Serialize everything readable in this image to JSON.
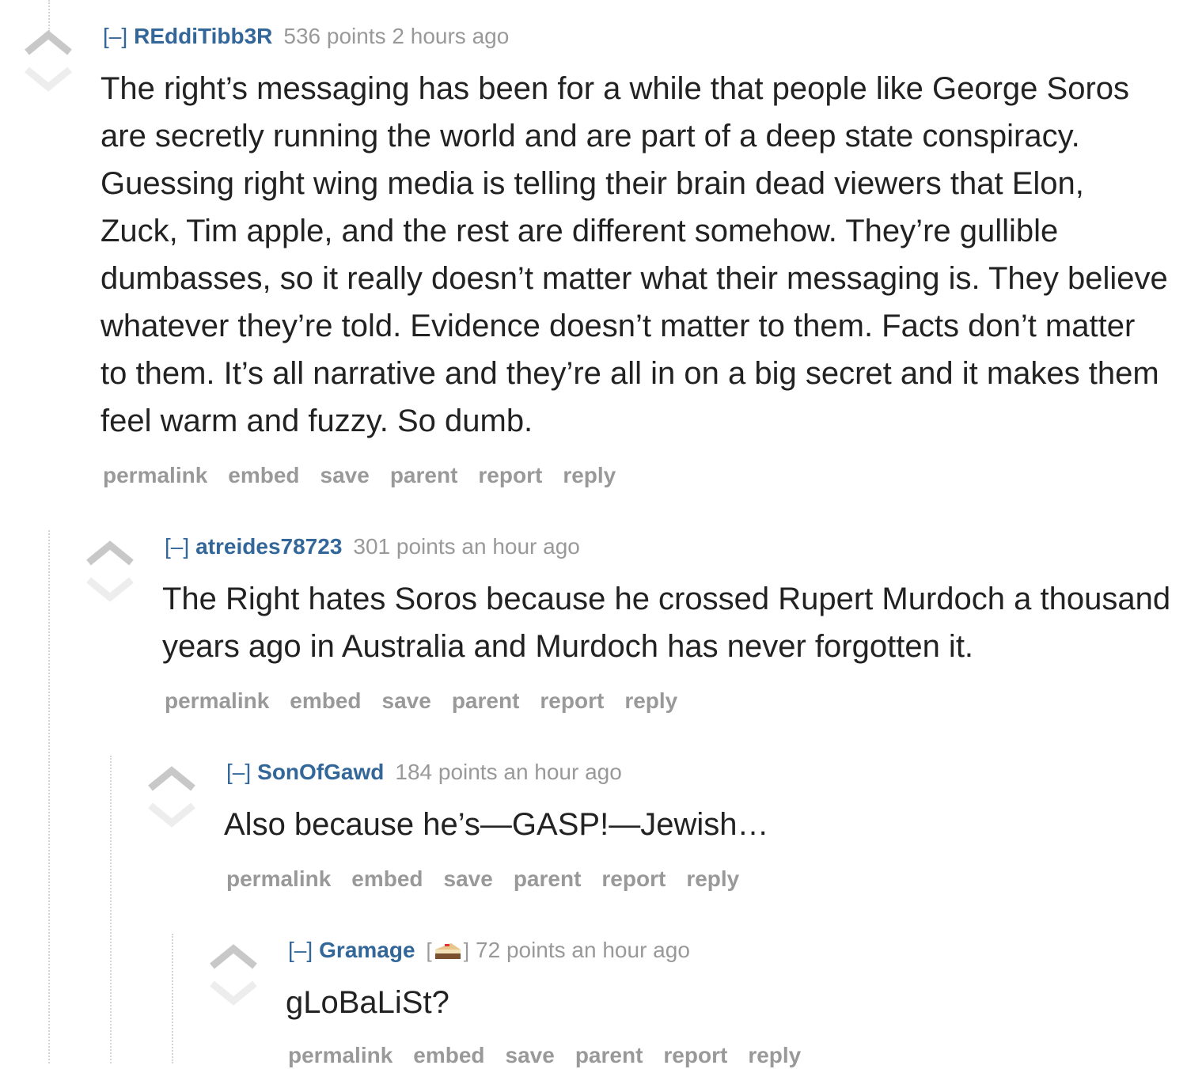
{
  "icons": {
    "upvote": "upvote-arrow-icon",
    "downvote": "downvote-arrow-icon",
    "flair": "cake-flair-icon"
  },
  "colors": {
    "author": "#336699",
    "meta": "#999999",
    "text": "#222222",
    "thread_line": "#d6d6d6"
  },
  "comments": [
    {
      "collapse": "[–]",
      "author": "REddiTibb3R",
      "score_time": "536 points 2 hours ago",
      "body": "The right’s messaging has been for a while that people like George Soros are secretly running the world and are part of a deep state conspiracy. Guessing right wing media is telling their brain dead viewers that Elon, Zuck, Tim apple, and the rest are different somehow. They’re gullible dumbasses, so it really doesn’t matter what their messaging is. They believe whatever they’re told. Evidence doesn’t matter to them. Facts don’t matter to them. It’s all narrative and they’re all in on a big secret and it makes them feel warm and fuzzy. So dumb."
    },
    {
      "collapse": "[–]",
      "author": "atreides78723",
      "score_time": "301 points an hour ago",
      "body": "The Right hates Soros because he crossed Rupert Murdoch a thousand years ago in Australia and Murdoch has never forgotten it."
    },
    {
      "collapse": "[–]",
      "author": "SonOfGawd",
      "score_time": "184 points an hour ago",
      "body": "Also because he’s—GASP!—Jewish…"
    },
    {
      "collapse": "[–]",
      "author": "Gramage",
      "flair_open": "[",
      "flair_close": "]",
      "score_time": "72 points an hour ago",
      "body": "gLoBaLiSt?"
    }
  ],
  "buttons": {
    "permalink": "permalink",
    "embed": "embed",
    "save": "save",
    "parent": "parent",
    "report": "report",
    "reply": "reply"
  }
}
